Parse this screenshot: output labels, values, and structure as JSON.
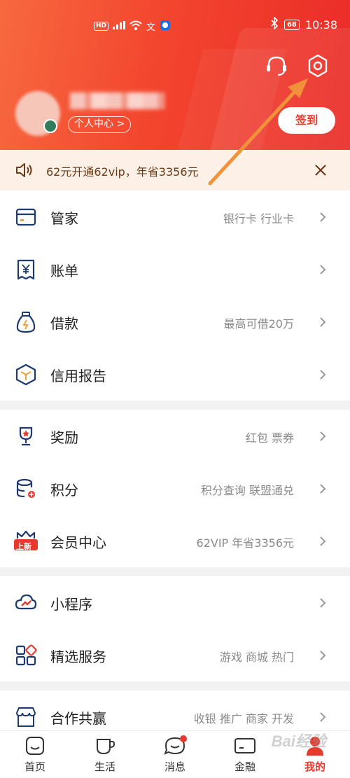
{
  "status_bar": {
    "network": "HD",
    "signal": "5G",
    "time": "10:38",
    "battery": "68"
  },
  "header": {
    "personal_center": "个人中心 >",
    "checkin": "签到"
  },
  "notice": {
    "text": "62元开通62vip，年省3356元"
  },
  "group1": [
    {
      "label": "管家",
      "sub": "银行卡 行业卡",
      "icon": "card-icon"
    },
    {
      "label": "账单",
      "sub": "",
      "icon": "bill-icon"
    },
    {
      "label": "借款",
      "sub": "最高可借20万",
      "icon": "loan-bag-icon"
    },
    {
      "label": "信用报告",
      "sub": "",
      "icon": "credit-hexagon-icon"
    }
  ],
  "group2": [
    {
      "label": "奖励",
      "sub": "红包 票券",
      "icon": "trophy-icon"
    },
    {
      "label": "积分",
      "sub": "积分查询 联盟通兑",
      "icon": "points-coins-icon"
    },
    {
      "label": "会员中心",
      "sub": "62VIP 年省3356元",
      "icon": "vip-crown-icon",
      "badge": "上新"
    }
  ],
  "group3": [
    {
      "label": "小程序",
      "sub": "",
      "icon": "mini-program-icon"
    },
    {
      "label": "精选服务",
      "sub": "游戏 商城 热门",
      "icon": "services-grid-icon"
    }
  ],
  "group4": [
    {
      "label": "合作共赢",
      "sub": "收银 推广 商家 开发",
      "icon": "store-icon"
    }
  ],
  "tabs": [
    {
      "label": "首页",
      "icon": "home-icon"
    },
    {
      "label": "生活",
      "icon": "cup-icon"
    },
    {
      "label": "消息",
      "icon": "message-icon"
    },
    {
      "label": "金融",
      "icon": "finance-card-icon"
    },
    {
      "label": "我的",
      "icon": "profile-icon"
    }
  ],
  "watermark": "Bai经验",
  "colors": {
    "brand_red": "#e8392d",
    "icon_navy": "#1f3a6e",
    "notice_bg": "#fdf1e7",
    "annotation_arrow": "#f2913a"
  }
}
